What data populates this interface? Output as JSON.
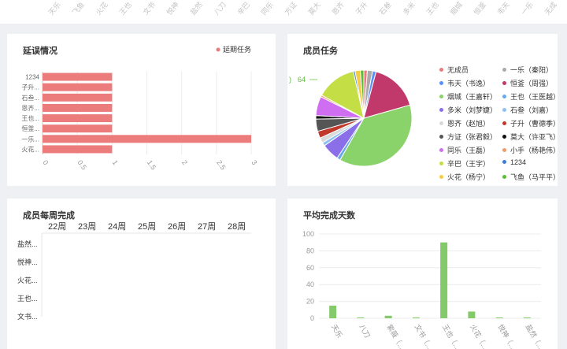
{
  "top_strip": {
    "tick_labels": [
      "天乐",
      "飞鱼",
      "火花",
      "王也",
      "文书",
      "悦神",
      "盐然",
      "八刀",
      "辛巴",
      "同乐",
      "方证",
      "莫大",
      "恩齐",
      "子升",
      "石叁",
      "多米",
      "王也",
      "烟城",
      "恒釜",
      "韦天",
      "一乐",
      "无成"
    ]
  },
  "delay_card": {
    "title": "延误情况",
    "legend_label": "延期任务",
    "accent": "#ec7b7b"
  },
  "members_card": {
    "title": "成员任务",
    "callout_prefix": ")",
    "callout_value": "64",
    "legend": [
      {
        "label": "无成员",
        "color": "#ec7b7b"
      },
      {
        "label": "一乐（秦阳）",
        "color": "#aaaaaa"
      },
      {
        "label": "韦天（书逸）",
        "color": "#5b8ff9"
      },
      {
        "label": "恒釜（周强）",
        "color": "#c0396a"
      },
      {
        "label": "烟城（王嘉轩）",
        "color": "#8ad26a"
      },
      {
        "label": "王也（王医越）",
        "color": "#6aa9e8"
      },
      {
        "label": "多米（刘梦婕）",
        "color": "#8b6fe8"
      },
      {
        "label": "石叁（刘嘉）",
        "color": "#8ec1f0"
      },
      {
        "label": "恩齐（赵旭）",
        "color": "#d9d9d9"
      },
      {
        "label": "子升（曹德季）",
        "color": "#c0392b"
      },
      {
        "label": "方证（张君毅）",
        "color": "#555555"
      },
      {
        "label": "莫大（许亚飞）",
        "color": "#111111"
      },
      {
        "label": "同乐（王磊）",
        "color": "#cf6ef0"
      },
      {
        "label": "小手（杨艳伟）",
        "color": "#f09a6a"
      },
      {
        "label": "辛巴（王宇）",
        "color": "#c3df45"
      },
      {
        "label": "1234",
        "color": "#3d7bd9"
      },
      {
        "label": "火花（杨宁）",
        "color": "#f5cc45"
      },
      {
        "label": "飞鱼（马平平）",
        "color": "#5dbb3a"
      }
    ]
  },
  "weekly_card": {
    "title": "成员每周完成",
    "weeks": [
      "22周",
      "23周",
      "24周",
      "25周",
      "26周",
      "27周",
      "28周"
    ],
    "members": [
      "盐然...",
      "悦神...",
      "火花...",
      "王也...",
      "文书..."
    ]
  },
  "avg_card": {
    "title": "平均完成天数",
    "accent": "#84c96a"
  },
  "chart_data": [
    {
      "type": "bar",
      "orientation": "horizontal",
      "title": "延误情况",
      "series": [
        {
          "name": "延期任务",
          "values": [
            1,
            1,
            1,
            1,
            1,
            1,
            3,
            1
          ]
        }
      ],
      "categories": [
        "1234",
        "子升...",
        "石叁...",
        "恩齐...",
        "王也...",
        "恒釜...",
        "一乐...",
        "火花..."
      ],
      "x_ticks": [
        "0",
        "0.5",
        "1",
        "1.5",
        "2",
        "2.5",
        "3"
      ],
      "xlim": [
        0,
        3
      ],
      "grid": true,
      "legend": "top-right"
    },
    {
      "type": "pie",
      "title": "成员任务",
      "slices": [
        {
          "label": "无成员",
          "value": 2,
          "color": "#ec7b7b"
        },
        {
          "label": "一乐（秦阳）",
          "value": 3,
          "color": "#aaaaaa"
        },
        {
          "label": "韦天（书逸）",
          "value": 2,
          "color": "#5b8ff9"
        },
        {
          "label": "恒釜（周强）",
          "value": 28,
          "color": "#c0396a"
        },
        {
          "label": "烟城（王嘉轩）",
          "value": 64,
          "color": "#8ad26a"
        },
        {
          "label": "王也（王医越）",
          "value": 2,
          "color": "#6aa9e8"
        },
        {
          "label": "多米（刘梦婕）",
          "value": 10,
          "color": "#8b6fe8"
        },
        {
          "label": "石叁（刘嘉）",
          "value": 2,
          "color": "#8ec1f0"
        },
        {
          "label": "恩齐（赵旭）",
          "value": 3,
          "color": "#d9d9d9"
        },
        {
          "label": "子升（曹德季）",
          "value": 4,
          "color": "#c0392b"
        },
        {
          "label": "方证（张君毅）",
          "value": 7,
          "color": "#555555"
        },
        {
          "label": "莫大（许亚飞）",
          "value": 2,
          "color": "#111111"
        },
        {
          "label": "同乐（王磊）",
          "value": 11,
          "color": "#cf6ef0"
        },
        {
          "label": "小手（杨艳伟）",
          "value": 1,
          "color": "#f09a6a"
        },
        {
          "label": "辛巴（王宇）",
          "value": 23,
          "color": "#c3df45"
        },
        {
          "label": "1234",
          "value": 1,
          "color": "#3d7bd9"
        },
        {
          "label": "火花（杨宁）",
          "value": 3,
          "color": "#f5cc45"
        },
        {
          "label": "飞鱼（马平平）",
          "value": 2,
          "color": "#5dbb3a"
        }
      ]
    },
    {
      "type": "table",
      "title": "成员每周完成",
      "columns": [
        "22周",
        "23周",
        "24周",
        "25周",
        "26周",
        "27周",
        "28周"
      ],
      "rows": [
        "盐然...",
        "悦神...",
        "火花...",
        "王也...",
        "文书..."
      ]
    },
    {
      "type": "bar",
      "title": "平均完成天数",
      "categories": [
        "天乐",
        "八刀",
        "紫薇（...",
        "文书（...",
        "王也（...",
        "火花（...",
        "悦神（...",
        "盐然（..."
      ],
      "values": [
        15,
        1,
        3,
        1,
        90,
        8,
        1,
        1
      ],
      "y_ticks": [
        "0",
        "20",
        "40",
        "60",
        "80",
        "100"
      ],
      "ylim": [
        0,
        100
      ],
      "grid": true
    }
  ]
}
